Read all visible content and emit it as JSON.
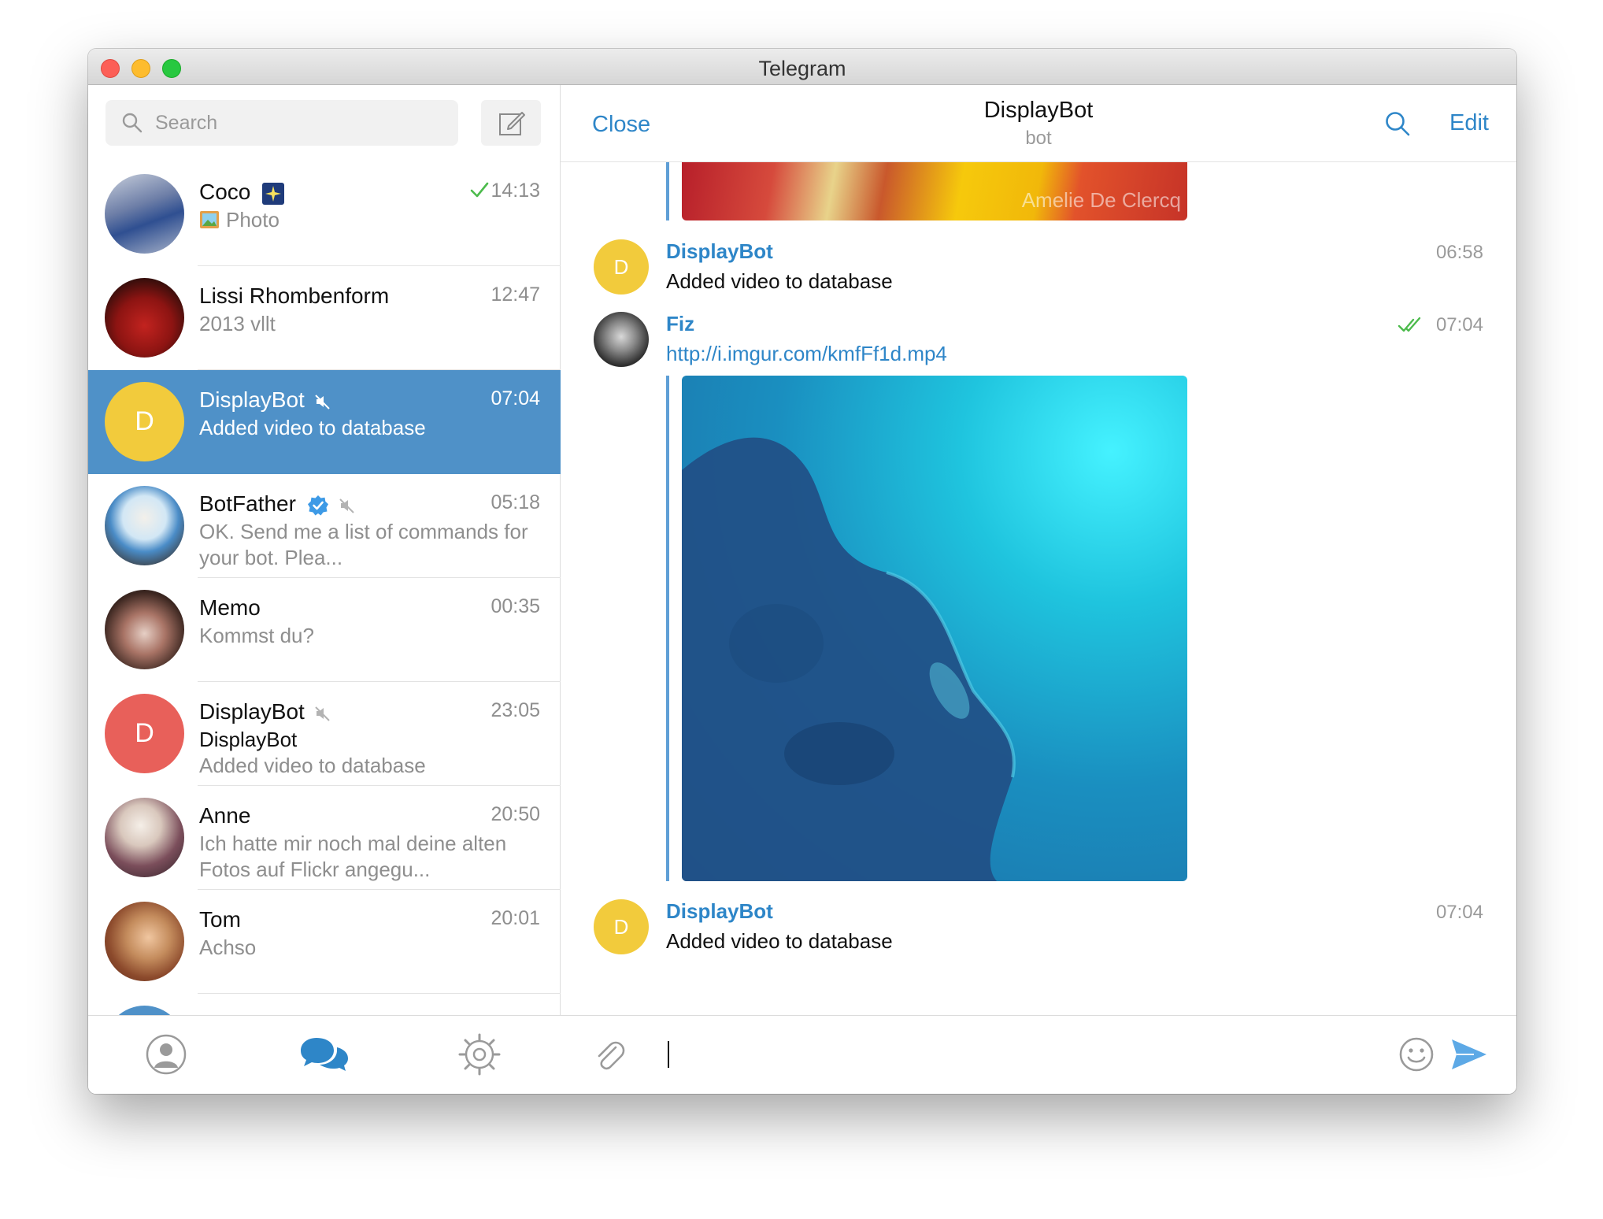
{
  "window": {
    "title": "Telegram"
  },
  "sidebar": {
    "search": {
      "placeholder": "Search"
    },
    "chats": [
      {
        "name": "Coco",
        "time": "14:13",
        "preview": "Photo",
        "status": "read-single"
      },
      {
        "name": "Lissi Rhombenform",
        "time": "12:47",
        "preview": "2013 vllt"
      },
      {
        "name": "DisplayBot",
        "time": "07:04",
        "preview": "Added video to database",
        "avatar_letter": "D",
        "muted": true,
        "active": true
      },
      {
        "name": "BotFather",
        "time": "05:18",
        "preview": "OK. Send me a list of commands for your bot. Plea...",
        "verified": true,
        "muted": true
      },
      {
        "name": "Memo",
        "time": "00:35",
        "preview": "Kommst du?"
      },
      {
        "name": "DisplayBot",
        "time": "23:05",
        "preview_sender": "DisplayBot",
        "preview": "Added video to database",
        "avatar_letter": "D",
        "muted": true
      },
      {
        "name": "Anne",
        "time": "20:50",
        "preview": "Ich hatte mir noch mal deine alten Fotos auf Flickr angegu..."
      },
      {
        "name": "Tom",
        "time": "20:01",
        "preview": "Achso"
      }
    ],
    "tabs": [
      "contacts-tab",
      "chats-tab",
      "settings-tab"
    ]
  },
  "chat": {
    "close_label": "Close",
    "title": "DisplayBot",
    "subtitle": "bot",
    "edit_label": "Edit",
    "prev_media_watermark": "Amelie De Clercq",
    "messages": [
      {
        "sender": "DisplayBot",
        "avatar_letter": "D",
        "text": "Added video to database",
        "time": "06:58"
      },
      {
        "sender": "Fiz",
        "link": "http://i.imgur.com/kmfFf1d.mp4",
        "time": "07:04",
        "status": "read-double"
      },
      {
        "sender": "DisplayBot",
        "avatar_letter": "D",
        "text": "Added video to database",
        "time": "07:04"
      }
    ],
    "composer": {
      "value": ""
    }
  },
  "colors": {
    "accent": "#2e86c8",
    "active_row": "#4f91c8",
    "displaybot_yellow": "#f2cb3c",
    "displaybot_red": "#e8605a",
    "check_green": "#4cbb4c"
  }
}
